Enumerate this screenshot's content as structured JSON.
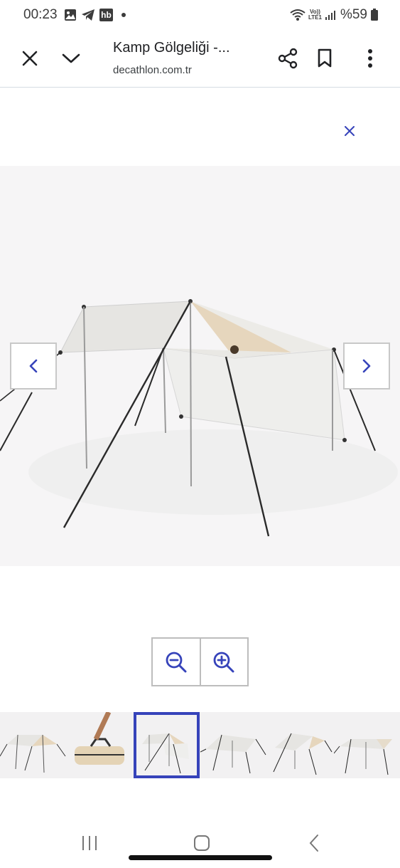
{
  "status_bar": {
    "time": "00:23",
    "notification_icons": [
      "gallery-icon",
      "telegram-icon",
      "hb-app-icon"
    ],
    "hb_label": "hb",
    "network_label_top": "Vo))",
    "network_label_bottom": "LTE1",
    "battery_text": "%59"
  },
  "browser": {
    "title": "Kamp Gölgeliği -...",
    "domain": "decathlon.com.tr",
    "buttons": [
      "close-icon",
      "chevron-down-icon",
      "share-icon",
      "bookmark-icon",
      "more-vert-icon"
    ]
  },
  "viewer": {
    "close_icon": "close-icon",
    "prev_icon": "chevron-left-icon",
    "next_icon": "chevron-right-icon",
    "zoom_out_icon": "zoom-out-icon",
    "zoom_in_icon": "zoom-in-icon",
    "thumbnail_count": 7,
    "selected_thumbnail": 3
  },
  "colors": {
    "accent": "#3643ba",
    "tarp_grey": "#e6e5e2",
    "tarp_beige": "#e6d6bd"
  },
  "system_nav": [
    "recents-icon",
    "home-icon",
    "back-icon"
  ]
}
